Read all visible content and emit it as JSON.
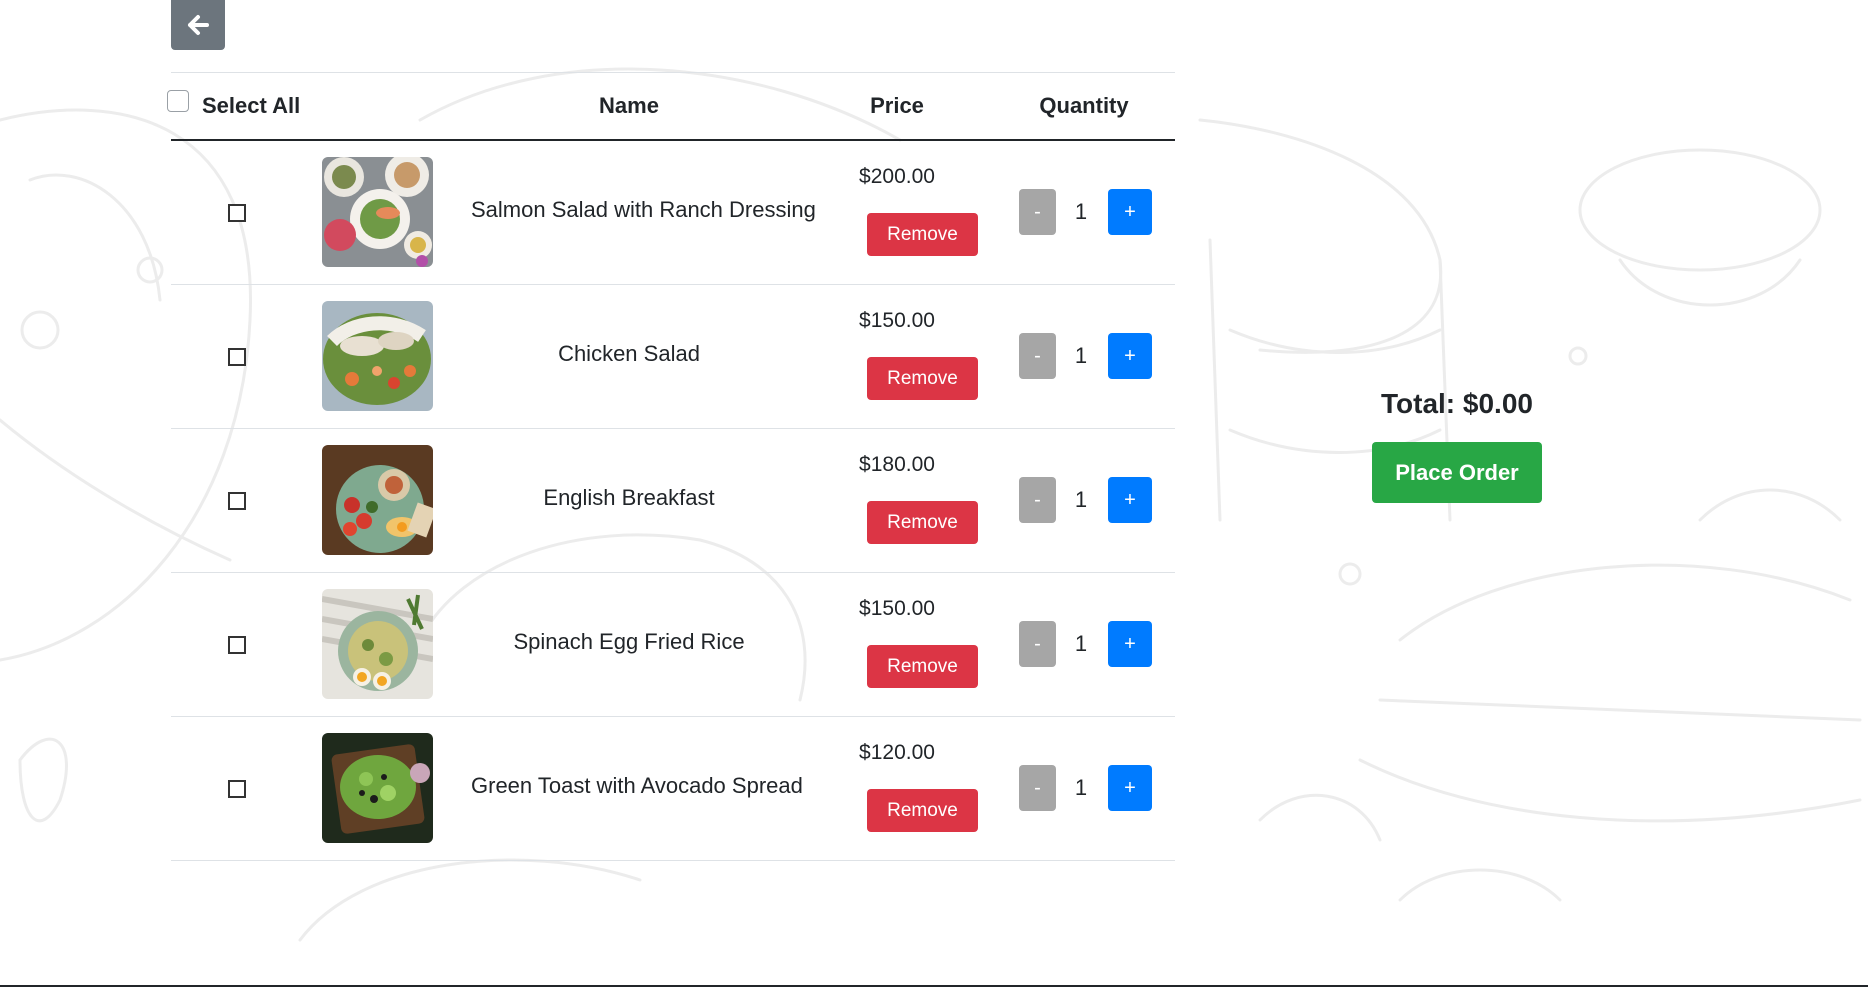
{
  "header": {
    "back_icon": "arrow-left-icon"
  },
  "table": {
    "columns": {
      "select_all": "Select All",
      "name": "Name",
      "price": "Price",
      "quantity": "Quantity"
    },
    "rows": [
      {
        "name": "Salmon Salad with Ranch Dressing",
        "price": "$200.00",
        "remove_label": "Remove",
        "minus_label": "-",
        "quantity": "1",
        "plus_label": "+"
      },
      {
        "name": "Chicken Salad",
        "price": "$150.00",
        "remove_label": "Remove",
        "minus_label": "-",
        "quantity": "1",
        "plus_label": "+"
      },
      {
        "name": "English Breakfast",
        "price": "$180.00",
        "remove_label": "Remove",
        "minus_label": "-",
        "quantity": "1",
        "plus_label": "+"
      },
      {
        "name": "Spinach Egg Fried Rice",
        "price": "$150.00",
        "remove_label": "Remove",
        "minus_label": "-",
        "quantity": "1",
        "plus_label": "+"
      },
      {
        "name": "Green Toast with Avocado Spread",
        "price": "$120.00",
        "remove_label": "Remove",
        "minus_label": "-",
        "quantity": "1",
        "plus_label": "+"
      }
    ]
  },
  "summary": {
    "total": "Total: $0.00",
    "place_order_label": "Place Order"
  },
  "colors": {
    "back_button": "#6c757d",
    "remove_button": "#dc3545",
    "minus_button": "#a6a6a6",
    "plus_button": "#007bff",
    "place_order_button": "#28a745"
  }
}
